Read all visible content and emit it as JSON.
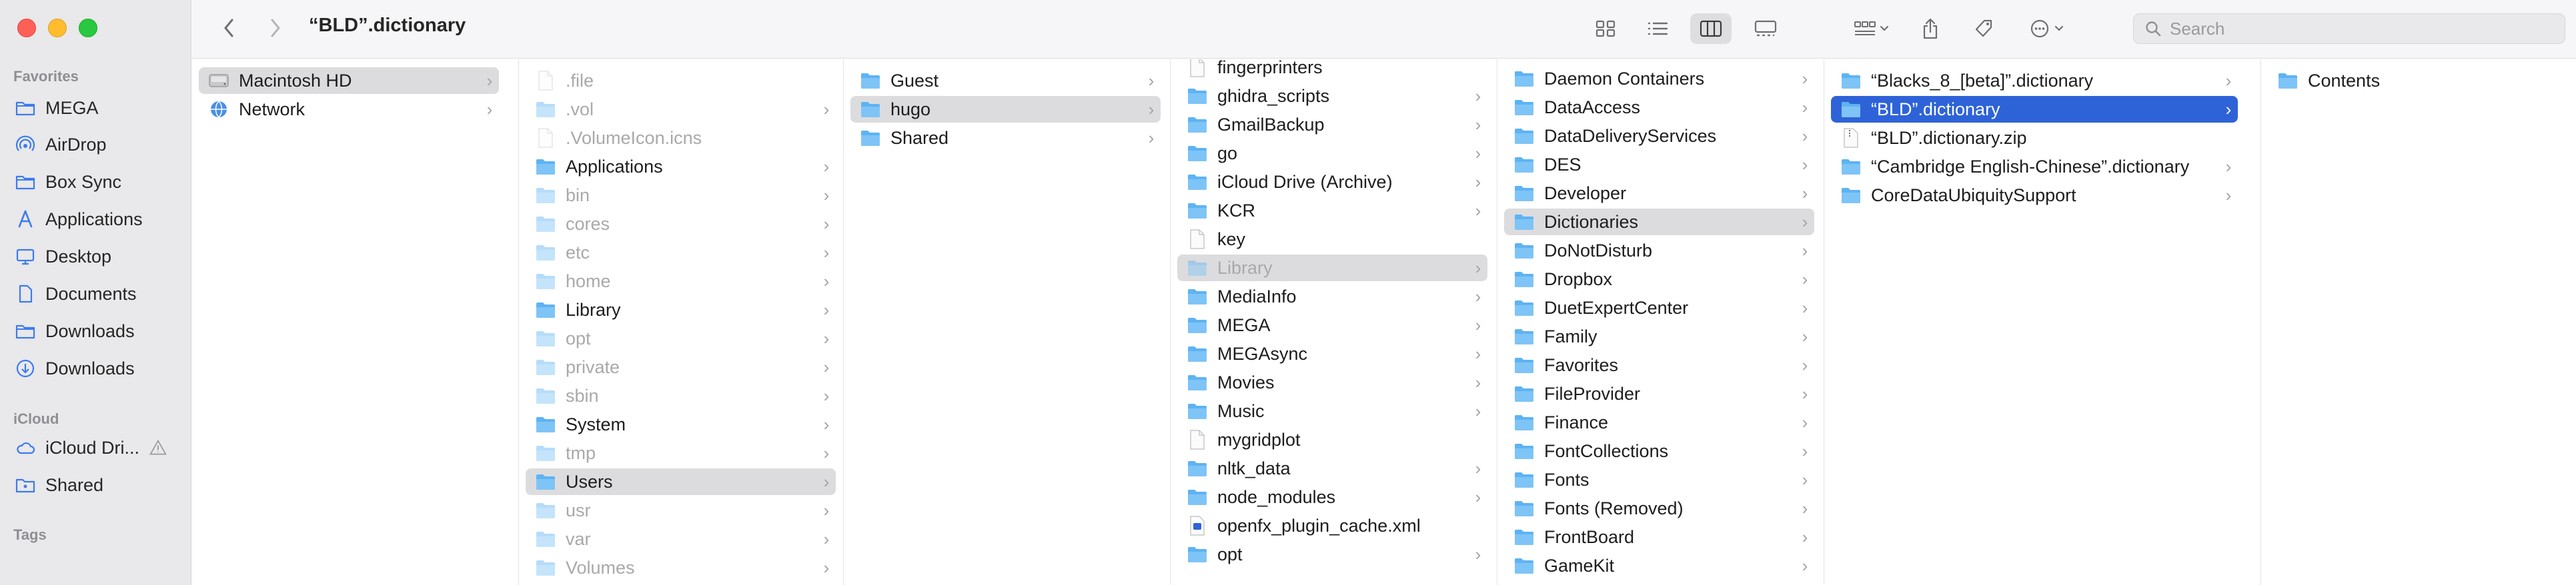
{
  "window": {
    "title": "“BLD”.dictionary"
  },
  "sidebar": {
    "favorites_header": "Favorites",
    "favorites": [
      {
        "label": "MEGA",
        "icon": "folder-icon"
      },
      {
        "label": "AirDrop",
        "icon": "airdrop-icon"
      },
      {
        "label": "Box Sync",
        "icon": "folder-icon"
      },
      {
        "label": "Applications",
        "icon": "applications-icon"
      },
      {
        "label": "Desktop",
        "icon": "desktop-icon"
      },
      {
        "label": "Documents",
        "icon": "document-icon"
      },
      {
        "label": "Downloads",
        "icon": "folder-icon"
      },
      {
        "label": "Downloads",
        "icon": "download-icon"
      }
    ],
    "icloud_header": "iCloud",
    "icloud": [
      {
        "label": "iCloud Dri...",
        "icon": "cloud-icon",
        "warning": true
      },
      {
        "label": "Shared",
        "icon": "shared-folder-icon"
      }
    ],
    "tags_header": "Tags"
  },
  "toolbar": {
    "back_icon": "chevron-left-icon",
    "forward_icon": "chevron-right-icon",
    "view_modes": [
      "icon-view",
      "list-view",
      "column-view",
      "gallery-view"
    ],
    "active_view": "column-view",
    "search_placeholder": "Search"
  },
  "colors": {
    "accent": "#2e63d8",
    "folder": "#5eb3f2",
    "sidebar_icon": "#3b7bf0",
    "sidebar_bg": "#e9e8ea"
  },
  "columns": [
    {
      "name": "volumes",
      "items": [
        {
          "label": "Macintosh HD",
          "icon": "disk",
          "chevron": true,
          "selected": "grey"
        },
        {
          "label": "Network",
          "icon": "globe",
          "chevron": true
        }
      ]
    },
    {
      "name": "root",
      "items": [
        {
          "label": ".file",
          "icon": "file",
          "dim": true
        },
        {
          "label": ".vol",
          "icon": "folder",
          "dim": true,
          "chevron": true
        },
        {
          "label": ".VolumeIcon.icns",
          "icon": "file",
          "dim": true
        },
        {
          "label": "Applications",
          "icon": "folder",
          "chevron": true
        },
        {
          "label": "bin",
          "icon": "folder",
          "dim": true,
          "chevron": true
        },
        {
          "label": "cores",
          "icon": "folder",
          "dim": true,
          "chevron": true
        },
        {
          "label": "etc",
          "icon": "folder",
          "dim": true,
          "chevron": true
        },
        {
          "label": "home",
          "icon": "folder",
          "dim": true,
          "chevron": true
        },
        {
          "label": "Library",
          "icon": "folder",
          "chevron": true
        },
        {
          "label": "opt",
          "icon": "folder",
          "dim": true,
          "chevron": true
        },
        {
          "label": "private",
          "icon": "folder",
          "dim": true,
          "chevron": true
        },
        {
          "label": "sbin",
          "icon": "folder",
          "dim": true,
          "chevron": true
        },
        {
          "label": "System",
          "icon": "folder",
          "chevron": true
        },
        {
          "label": "tmp",
          "icon": "folder",
          "dim": true,
          "chevron": true
        },
        {
          "label": "Users",
          "icon": "folder",
          "chevron": true,
          "selected": "grey"
        },
        {
          "label": "usr",
          "icon": "folder",
          "dim": true,
          "chevron": true
        },
        {
          "label": "var",
          "icon": "folder",
          "dim": true,
          "chevron": true
        },
        {
          "label": "Volumes",
          "icon": "folder",
          "dim": true,
          "chevron": true
        }
      ]
    },
    {
      "name": "users",
      "items": [
        {
          "label": "Guest",
          "icon": "folder",
          "chevron": true
        },
        {
          "label": "hugo",
          "icon": "folder",
          "chevron": true,
          "selected": "grey"
        },
        {
          "label": "Shared",
          "icon": "folder",
          "chevron": true
        }
      ]
    },
    {
      "name": "home",
      "items": [
        {
          "label": "fingerprinters",
          "icon": "file"
        },
        {
          "label": "ghidra_scripts",
          "icon": "folder",
          "chevron": true
        },
        {
          "label": "GmailBackup",
          "icon": "folder",
          "chevron": true
        },
        {
          "label": "go",
          "icon": "folder",
          "chevron": true
        },
        {
          "label": "iCloud Drive (Archive)",
          "icon": "folder",
          "chevron": true
        },
        {
          "label": "KCR",
          "icon": "folder",
          "chevron": true
        },
        {
          "label": "key",
          "icon": "file"
        },
        {
          "label": "Library",
          "icon": "folder",
          "chevron": true,
          "selected": "grey",
          "dim": true
        },
        {
          "label": "MediaInfo",
          "icon": "folder",
          "chevron": true
        },
        {
          "label": "MEGA",
          "icon": "folder",
          "chevron": true
        },
        {
          "label": "MEGAsync",
          "icon": "folder",
          "chevron": true
        },
        {
          "label": "Movies",
          "icon": "folder",
          "chevron": true
        },
        {
          "label": "Music",
          "icon": "folder",
          "chevron": true
        },
        {
          "label": "mygridplot",
          "icon": "file"
        },
        {
          "label": "nltk_data",
          "icon": "folder",
          "chevron": true
        },
        {
          "label": "node_modules",
          "icon": "folder",
          "chevron": true
        },
        {
          "label": "openfx_plugin_cache.xml",
          "icon": "xml"
        },
        {
          "label": "opt",
          "icon": "folder",
          "chevron": true
        }
      ]
    },
    {
      "name": "library",
      "items": [
        {
          "label": "Daemon Containers",
          "icon": "folder",
          "chevron": true
        },
        {
          "label": "DataAccess",
          "icon": "folder",
          "chevron": true
        },
        {
          "label": "DataDeliveryServices",
          "icon": "folder",
          "chevron": true
        },
        {
          "label": "DES",
          "icon": "folder",
          "chevron": true
        },
        {
          "label": "Developer",
          "icon": "folder",
          "chevron": true
        },
        {
          "label": "Dictionaries",
          "icon": "folder",
          "chevron": true,
          "selected": "grey"
        },
        {
          "label": "DoNotDisturb",
          "icon": "folder",
          "chevron": true
        },
        {
          "label": "Dropbox",
          "icon": "folder",
          "chevron": true
        },
        {
          "label": "DuetExpertCenter",
          "icon": "folder",
          "chevron": true
        },
        {
          "label": "Family",
          "icon": "folder",
          "chevron": true
        },
        {
          "label": "Favorites",
          "icon": "folder",
          "chevron": true
        },
        {
          "label": "FileProvider",
          "icon": "folder",
          "chevron": true
        },
        {
          "label": "Finance",
          "icon": "folder",
          "chevron": true
        },
        {
          "label": "FontCollections",
          "icon": "folder",
          "chevron": true
        },
        {
          "label": "Fonts",
          "icon": "folder",
          "chevron": true
        },
        {
          "label": "Fonts (Removed)",
          "icon": "folder",
          "chevron": true
        },
        {
          "label": "FrontBoard",
          "icon": "folder",
          "chevron": true
        },
        {
          "label": "GameKit",
          "icon": "folder",
          "chevron": true
        }
      ]
    },
    {
      "name": "dictionaries",
      "items": [
        {
          "label": "“Blacks_8_[beta]”.dictionary",
          "icon": "folder",
          "chevron": true
        },
        {
          "label": "“BLD”.dictionary",
          "icon": "folder",
          "chevron": true,
          "selected": "blue"
        },
        {
          "label": "“BLD”.dictionary.zip",
          "icon": "zip"
        },
        {
          "label": "“Cambridge English-Chinese”.dictionary",
          "icon": "folder",
          "chevron": true
        },
        {
          "label": "CoreDataUbiquitySupport",
          "icon": "folder",
          "chevron": true
        }
      ]
    },
    {
      "name": "bld",
      "items": [
        {
          "label": "Contents",
          "icon": "folder"
        }
      ]
    }
  ]
}
